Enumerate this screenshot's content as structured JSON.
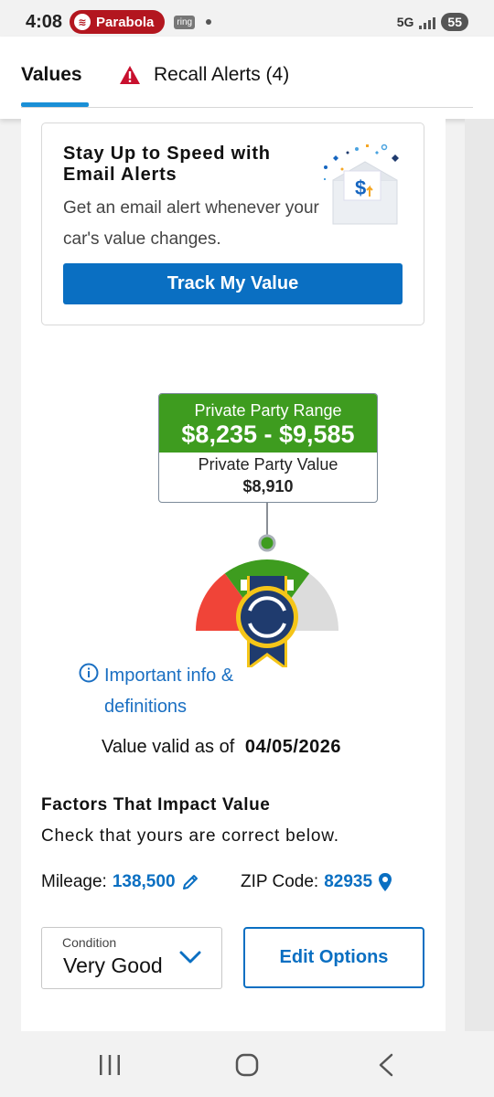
{
  "status_bar": {
    "time": "4:08",
    "app_pill": "Parabola",
    "ring_badge": "ring",
    "network": "5G",
    "battery": "55"
  },
  "tabs": {
    "values_label": "Values",
    "recall_label": "Recall Alerts (4)"
  },
  "email_card": {
    "title": "Stay Up to Speed with Email Alerts",
    "subtitle": "Get an email alert whenever your car's value changes.",
    "button_label": "Track My Value"
  },
  "price": {
    "range_label": "Private Party Range",
    "range_value": "$8,235 - $9,585",
    "value_label": "Private Party Value",
    "value": "$8,910"
  },
  "info_link": "Important info & definitions",
  "valid": {
    "label": "Value valid as of",
    "date": "04/05/2026"
  },
  "factors": {
    "title": "Factors That Impact Value",
    "subtitle": "Check that yours are correct below.",
    "mileage_label": "Mileage:",
    "mileage_value": "138,500",
    "zip_label": "ZIP Code:",
    "zip_value": "82935"
  },
  "condition": {
    "label": "Condition",
    "value": "Very Good"
  },
  "edit_options_label": "Edit Options",
  "colors": {
    "accent_blue": "#0a6fc2",
    "range_green": "#3e9c1f",
    "gauge_red": "#f04438",
    "alert_red": "#c8102e"
  }
}
